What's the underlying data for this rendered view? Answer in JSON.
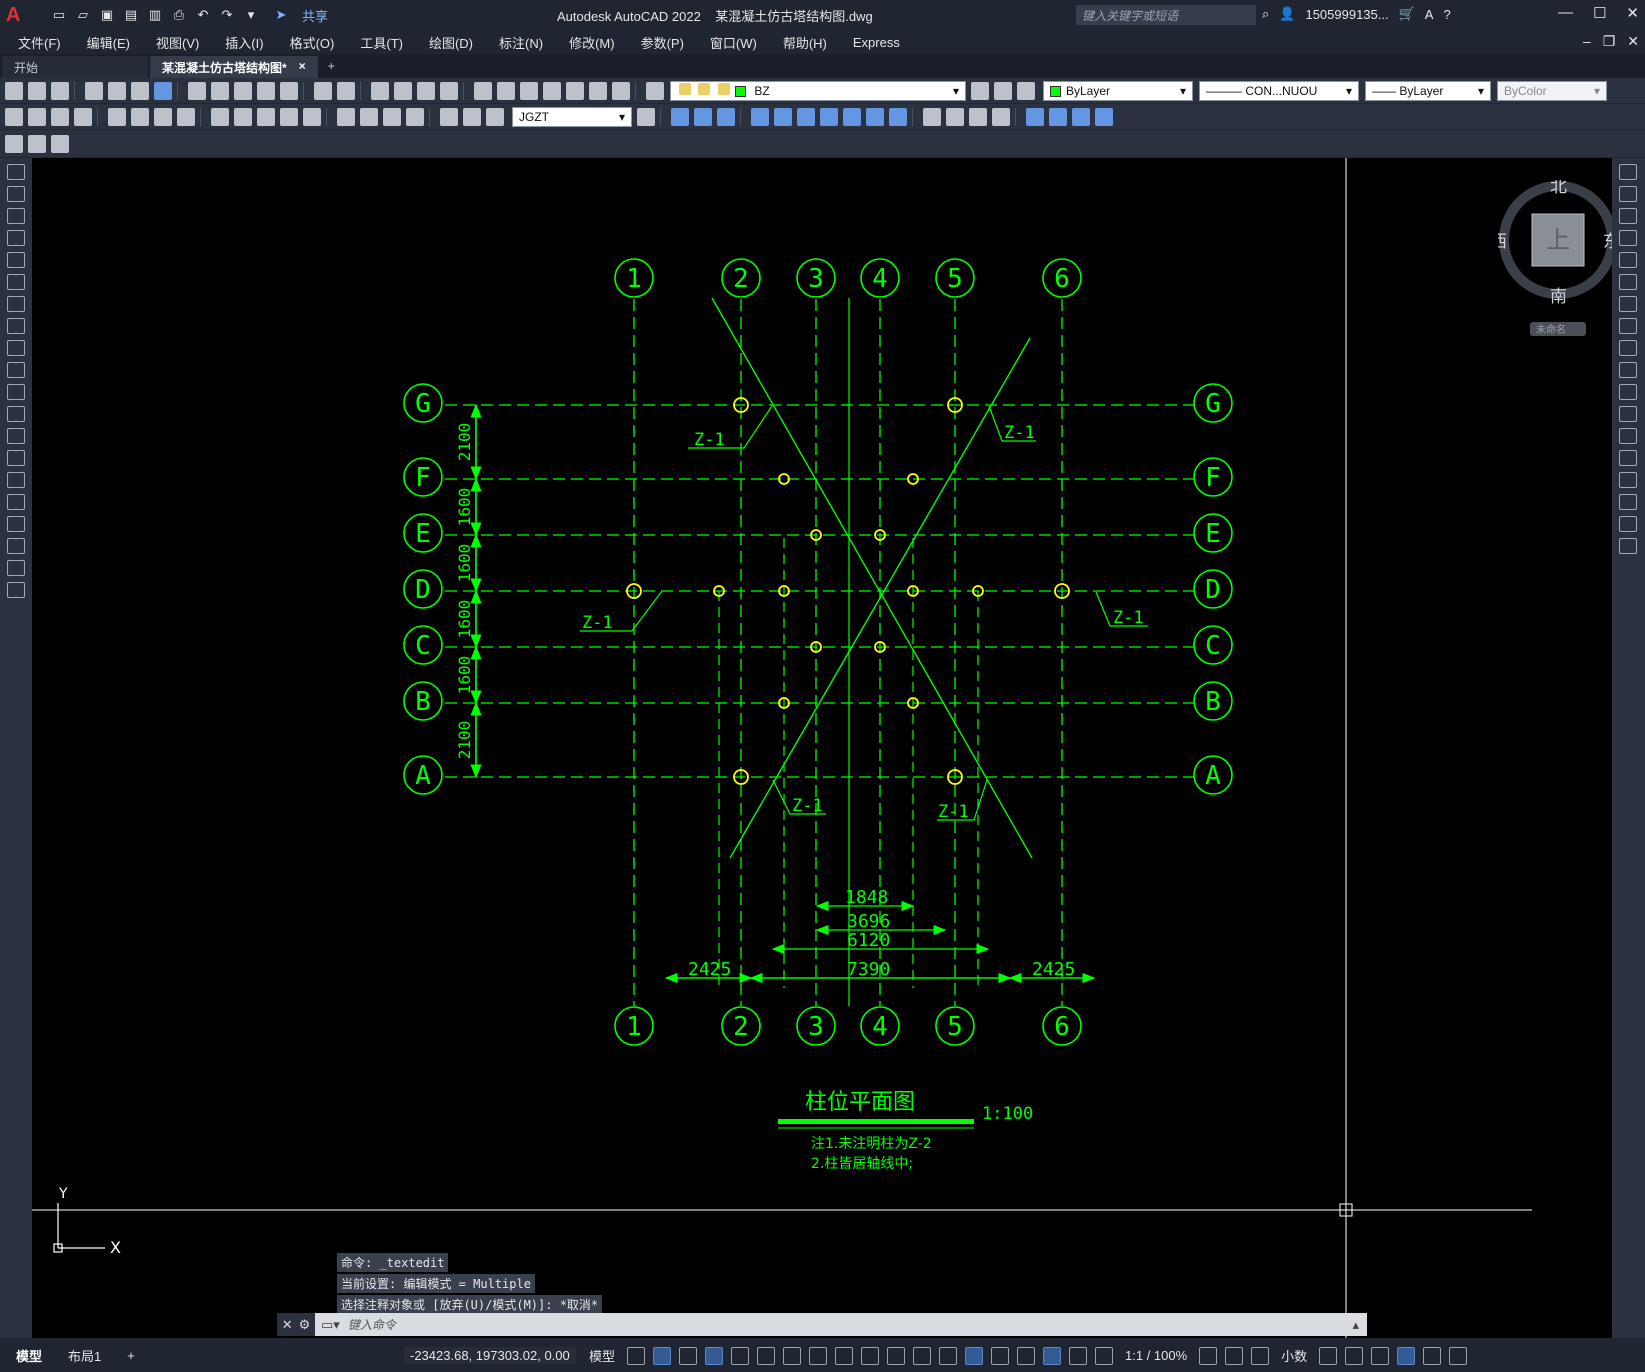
{
  "app": {
    "title": "Autodesk AutoCAD 2022",
    "document": "某混凝土仿古塔结构图.dwg",
    "share_label": "共享",
    "search_placeholder": "键入关键字或短语",
    "user": "1505999135...",
    "help": "?"
  },
  "menu": [
    "文件(F)",
    "编辑(E)",
    "视图(V)",
    "插入(I)",
    "格式(O)",
    "工具(T)",
    "绘图(D)",
    "标注(N)",
    "修改(M)",
    "参数(P)",
    "窗口(W)",
    "帮助(H)",
    "Express"
  ],
  "tabs": {
    "start": "开始",
    "active": "某混凝土仿古塔结构图*",
    "close": "×",
    "add": "+"
  },
  "layers": {
    "current_layer": "BZ",
    "color": "ByLayer",
    "linetype": "CON...NUOU",
    "lineweight": "ByLayer",
    "plotstyle": "ByColor",
    "dim_style": "JGZT",
    "layer_color": "#00ff00"
  },
  "drawing": {
    "grid_cols": [
      "1",
      "2",
      "3",
      "4",
      "5",
      "6"
    ],
    "grid_rows": [
      "G",
      "F",
      "E",
      "D",
      "C",
      "B",
      "A"
    ],
    "row_dims": [
      "2100",
      "1600",
      "1600",
      "1600",
      "1600",
      "2100"
    ],
    "bottom_dims": {
      "d1848": "1848",
      "d3696": "3696",
      "d6120": "6120",
      "d7390": "7390",
      "left2425": "2425",
      "right2425": "2425"
    },
    "column_label": "Z-1",
    "title": "柱位平面图",
    "scale": "1:100",
    "note1": "注1.未注明柱为Z-2",
    "note2": "2.柱皆居轴线中;",
    "line_color": "#00ff00",
    "column_color": "#ffff00",
    "ucs_x": "X",
    "ucs_y": "Y"
  },
  "viewcube": {
    "north": "北",
    "south": "南",
    "east": "东",
    "west": "西",
    "top": "上",
    "wcs": "未命名"
  },
  "command": {
    "history": [
      "命令: _textedit",
      "当前设置: 编辑模式 = Multiple",
      "选择注释对象或 [放弃(U)/模式(M)]: *取消*"
    ],
    "placeholder": "键入命令"
  },
  "status": {
    "model_tab": "模型",
    "layout_tab": "布局1",
    "add_tab": "+",
    "coords": "-23423.68, 197303.02, 0.00",
    "model": "模型",
    "scale": "1:1 / 100%",
    "units": "小数"
  }
}
